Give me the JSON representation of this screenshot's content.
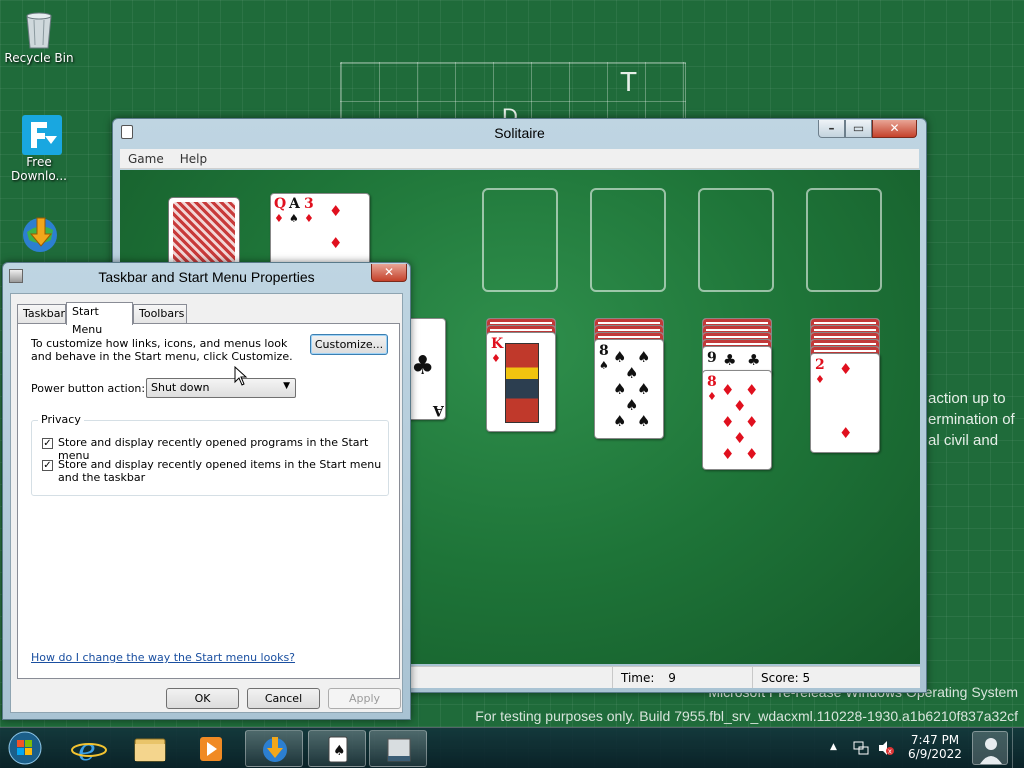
{
  "desktop": {
    "icons": [
      {
        "label": "Recycle Bin"
      },
      {
        "label": "Free\nDownlo..."
      },
      {
        "label": ""
      }
    ],
    "background_letters": [
      "T",
      "D"
    ],
    "background_text": {
      "line1": "action up to",
      "line2": "ermination of",
      "line3": "al civil and"
    },
    "watermark": {
      "line1": "Microsoft Pre-release Windows Operating System",
      "line2": "For testing purposes only. Build 7955.fbl_srv_wdacxml.110228-1930.a1b6210f837a32cf"
    }
  },
  "solitaire": {
    "title": "Solitaire",
    "menu": [
      "Game",
      "Help"
    ],
    "waste": [
      {
        "rank": "Q",
        "suit": "♦",
        "color": "red"
      },
      {
        "rank": "A",
        "suit": "♠",
        "color": "black"
      },
      {
        "rank": "3",
        "suit": "♦",
        "color": "red"
      }
    ],
    "tableau": [
      {
        "rank": "A",
        "suit": "♣",
        "color": "black"
      },
      {
        "rank": "K",
        "suit": "♦",
        "color": "red"
      },
      {
        "rank": "8",
        "suit": "♠",
        "color": "black"
      },
      {
        "rank": "9",
        "suit": "♣",
        "color": "black"
      },
      {
        "rank": "8",
        "suit": "♦",
        "color": "red"
      },
      {
        "rank": "2",
        "suit": "♦",
        "color": "red"
      }
    ],
    "status": {
      "time_label": "Time:",
      "time_value": "9",
      "score_label": "Score:",
      "score_value": "5"
    }
  },
  "dialog": {
    "title": "Taskbar and Start Menu Properties",
    "tabs": [
      "Taskbar",
      "Start Menu",
      "Toolbars"
    ],
    "active_tab": "Start Menu",
    "description": "To customize how links, icons, and menus look and behave in the Start menu, click Customize.",
    "customize_button": "Customize...",
    "power_label": "Power button action:",
    "power_value": "Shut down",
    "privacy_label": "Privacy",
    "checkbox1": "Store and display recently opened programs in the Start menu",
    "checkbox2": "Store and display recently opened items in the Start menu and the taskbar",
    "help_link": "How do I change the way the Start menu looks?",
    "ok": "OK",
    "cancel": "Cancel",
    "apply": "Apply"
  },
  "taskbar": {
    "time": "7:47 PM",
    "date": "6/9/2022"
  },
  "colors": {
    "desktop": "#1f6b3a",
    "felt": "#1e7438",
    "card_red": "#e0101e",
    "link": "#1a4fa0"
  }
}
